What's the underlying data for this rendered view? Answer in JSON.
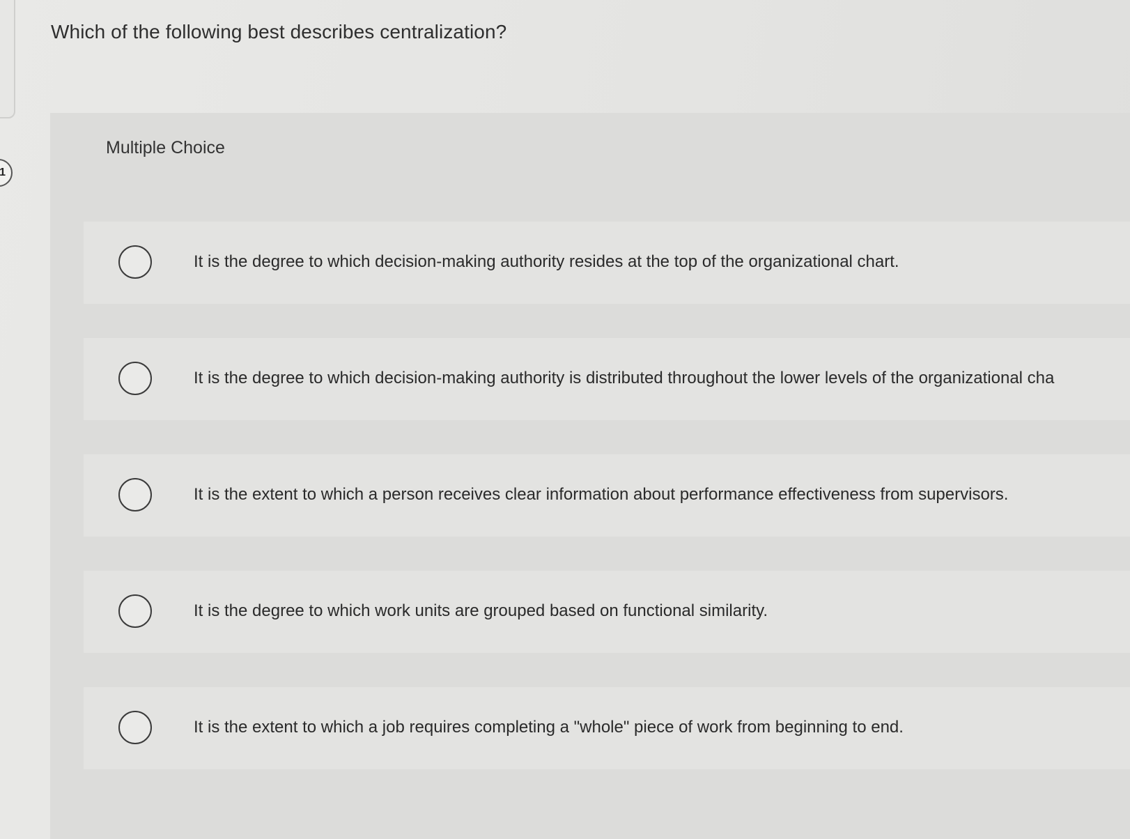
{
  "question": {
    "number": "1",
    "prompt": "Which of the following best describes centralization?"
  },
  "choices": {
    "type_label": "Multiple Choice",
    "options": [
      "It is the degree to which decision-making authority resides at the top of the organizational chart.",
      "It is the degree to which decision-making authority is distributed throughout the lower levels of the organizational cha",
      "It is the extent to which a person receives clear information about performance effectiveness from supervisors.",
      "It is the degree to which work units are grouped based on functional similarity.",
      "It is the extent to which a job requires completing a \"whole\" piece of work from beginning to end."
    ]
  },
  "colors": {
    "background": "#e6e6e4",
    "panel": "#dcdcda",
    "text": "#2b2b2b",
    "radio_border": "#3a3a3a"
  }
}
